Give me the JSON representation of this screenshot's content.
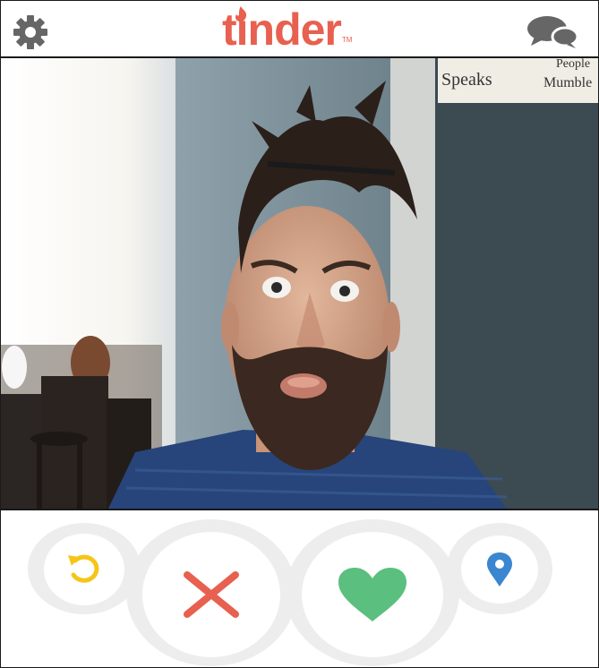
{
  "app": {
    "brand_name": "tinder",
    "brand_mark": "TM",
    "brand_color": "#e8604f"
  },
  "header": {
    "settings_icon": "gear-icon",
    "messages_icon": "chat-bubbles-icon"
  },
  "card": {
    "photo_description_icon": "profile-photo",
    "background_sign_lines": [
      "Speaks",
      "People",
      "Mumble"
    ]
  },
  "actions": {
    "rewind_icon": "rewind-icon",
    "rewind_color": "#f5c518",
    "nope_icon": "close-icon",
    "nope_color": "#e8604f",
    "like_icon": "heart-icon",
    "like_color": "#5bbf7f",
    "location_icon": "location-pin-icon",
    "location_color": "#3a86d0"
  }
}
